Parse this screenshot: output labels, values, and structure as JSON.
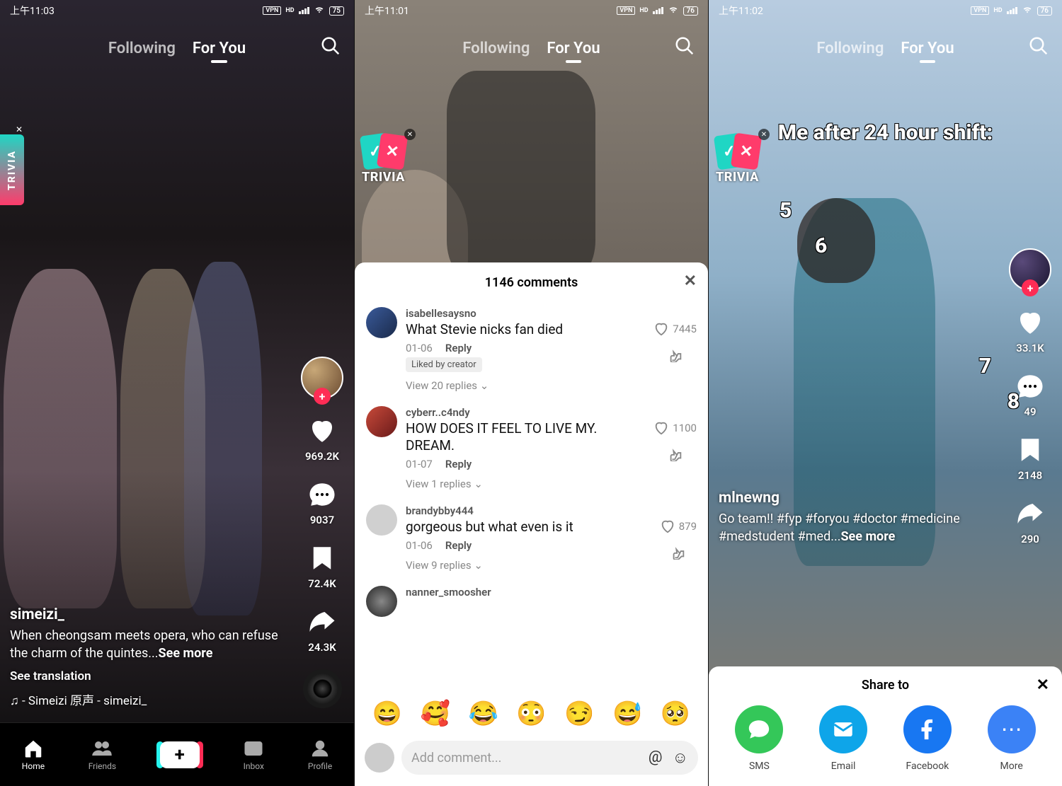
{
  "nav": {
    "following": "Following",
    "foryou": "For You",
    "home": "Home",
    "friends": "Friends",
    "inbox": "Inbox",
    "profile": "Profile"
  },
  "trivia": "TRIVIA",
  "phones": [
    {
      "time": "上午11:03",
      "battery": "75",
      "user": "simeizi_",
      "caption": "When cheongsam meets opera, who can refuse the charm of the quintes...",
      "seemore": "See more",
      "translation": "See translation",
      "music": "♫ - Simeizi  原声 - simeizi_",
      "actions": {
        "likes": "969.2K",
        "comments": "9037",
        "saves": "72.4K",
        "shares": "24.3K"
      }
    },
    {
      "time": "上午11:01",
      "battery": "76",
      "comments_title": "1146 comments",
      "add_comment": "Add comment...",
      "emojis": [
        "😄",
        "🥰",
        "😂",
        "😳",
        "😏",
        "😅",
        "🥺"
      ],
      "reply": "Reply",
      "liked_by": "Liked by creator",
      "comments": [
        {
          "user": "isabellesaysno",
          "text": "What Stevie nicks fan died",
          "date": "01-06",
          "likes": "7445",
          "replies": "View 20 replies",
          "liked_by_creator": true,
          "avatar": "linear-gradient(135deg,#3a5a9a,#1a2a4a)"
        },
        {
          "user": "cyberr..c4ndy",
          "text": "HOW DOES IT FEEL TO LIVE MY. DREAM.",
          "date": "01-07",
          "likes": "1100",
          "replies": "View 1 replies",
          "liked_by_creator": false,
          "avatar": "linear-gradient(135deg,#c84a3a,#6a1a1a)"
        },
        {
          "user": "brandybby444",
          "text": "gorgeous but what even is it",
          "date": "01-06",
          "likes": "879",
          "replies": "View 9 replies",
          "liked_by_creator": false,
          "avatar": "#d0d0d0"
        },
        {
          "user": "nanner_smoosher",
          "text": "",
          "date": "",
          "likes": "",
          "replies": "",
          "liked_by_creator": false,
          "avatar": "radial-gradient(circle,#888,#222)"
        }
      ]
    },
    {
      "time": "上午11:02",
      "battery": "76",
      "overlay_heading": "Me after 24 hour shift:",
      "overlay_nums": [
        "5",
        "6",
        "7",
        "8"
      ],
      "user": "mlnewng",
      "caption": "Go team!! #fyp #foryou #doctor #medicine #medstudent #med...",
      "seemore": "See more",
      "actions": {
        "likes": "33.1K",
        "comments": "49",
        "saves": "2148",
        "shares": "290"
      },
      "share": {
        "title": "Share to",
        "items": [
          "SMS",
          "Email",
          "Facebook",
          "More"
        ]
      }
    }
  ]
}
